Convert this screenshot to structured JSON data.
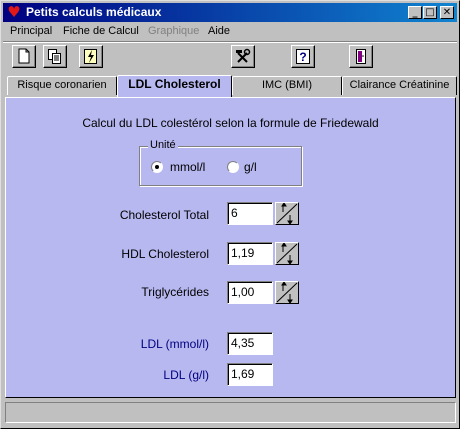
{
  "window": {
    "title": "Petits calculs médicaux"
  },
  "title_buttons": {
    "minimize": "_",
    "maximize": "□",
    "close": "✕"
  },
  "menu": [
    {
      "label": "Principal"
    },
    {
      "label": "Fiche de Calcul"
    },
    {
      "label": "Graphique"
    },
    {
      "label": "Aide"
    }
  ],
  "toolbar": {
    "icons": [
      "new-document-icon",
      "copy-icon",
      "lightning-icon",
      "tools-icon",
      "help-icon",
      "exit-door-icon"
    ],
    "help_glyph": "?"
  },
  "tabs": [
    {
      "label": "Risque coronarien"
    },
    {
      "label": "LDL Cholesterol",
      "active": true
    },
    {
      "label": "IMC (BMI)"
    },
    {
      "label": "Clairance Créatinine"
    }
  ],
  "panel": {
    "caption": "Calcul du LDL colestérol selon la formule de Friedewald",
    "unit_group": {
      "label": "Unité",
      "options": [
        {
          "label": "mmol/l",
          "selected": true
        },
        {
          "label": "g/l",
          "selected": false
        }
      ]
    },
    "inputs": [
      {
        "label": "Cholesterol Total",
        "value": "6"
      },
      {
        "label": "HDL Cholesterol",
        "value": "1,19"
      },
      {
        "label": "Triglycérides",
        "value": "1,00"
      }
    ],
    "results": [
      {
        "label": "LDL (mmol/l)",
        "value": "4,35"
      },
      {
        "label": "LDL (g/l)",
        "value": "1,69"
      }
    ]
  },
  "colors": {
    "panel_bg": "#b8b8f0",
    "title_start": "#000080",
    "title_end": "#1084d0",
    "result_label": "#000080"
  }
}
